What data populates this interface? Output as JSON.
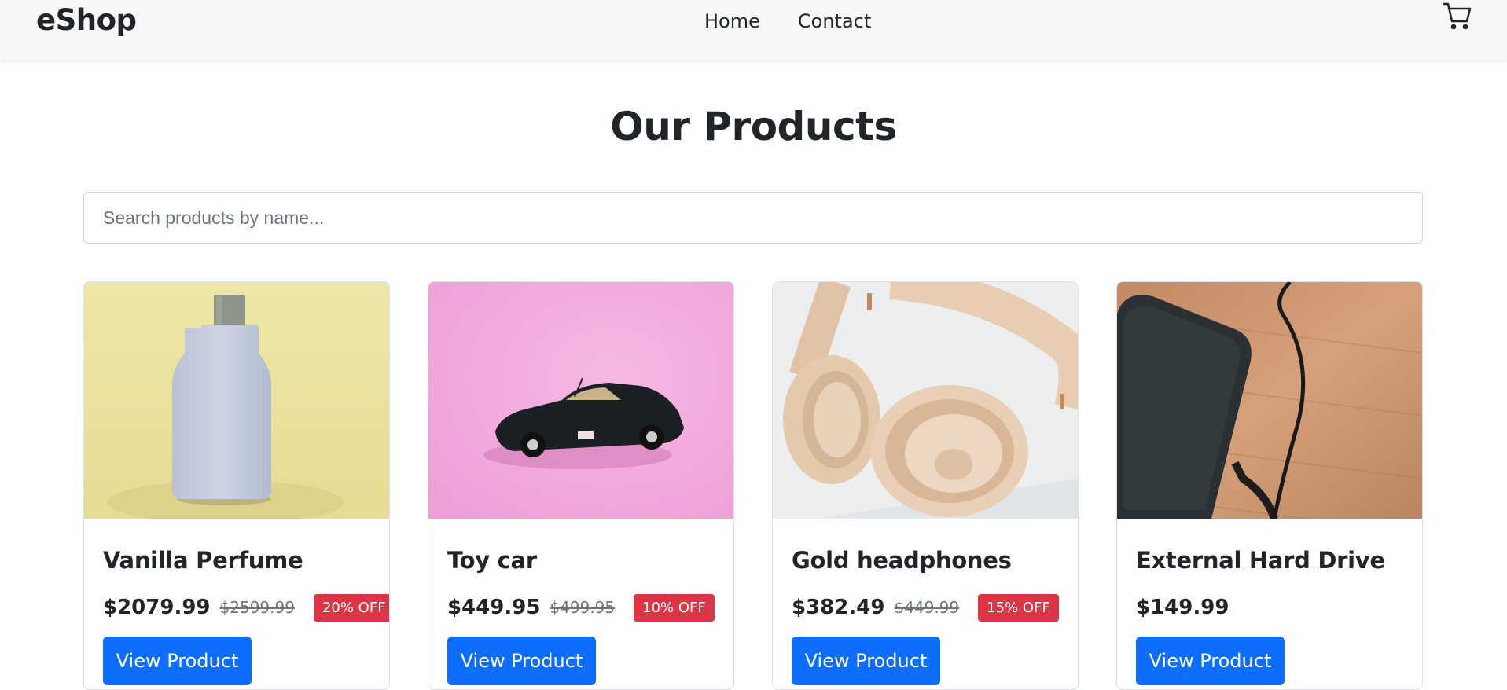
{
  "brand": "eShop",
  "nav": {
    "home": "Home",
    "contact": "Contact"
  },
  "cart_icon": "cart-icon",
  "page_title": "Our Products",
  "search": {
    "placeholder": "Search products by name...",
    "value": ""
  },
  "products": [
    {
      "name": "Vanilla Perfume",
      "price": "$2079.99",
      "old_price": "$2599.99",
      "discount": "20% OFF",
      "button": "View Product",
      "image": "perfume-bottle-image"
    },
    {
      "name": "Toy car",
      "price": "$449.95",
      "old_price": "$499.95",
      "discount": "10% OFF",
      "button": "View Product",
      "image": "toy-car-image"
    },
    {
      "name": "Gold headphones",
      "price": "$382.49",
      "old_price": "$449.99",
      "discount": "15% OFF",
      "button": "View Product",
      "image": "headphones-image"
    },
    {
      "name": "External Hard Drive",
      "price": "$149.99",
      "old_price": "",
      "discount": "",
      "button": "View Product",
      "image": "hard-drive-image"
    }
  ],
  "colors": {
    "primary": "#0d6efd",
    "discount": "#dc3545",
    "navbar_bg": "#f8f8f8",
    "text": "#212529",
    "muted": "#6c757d"
  }
}
